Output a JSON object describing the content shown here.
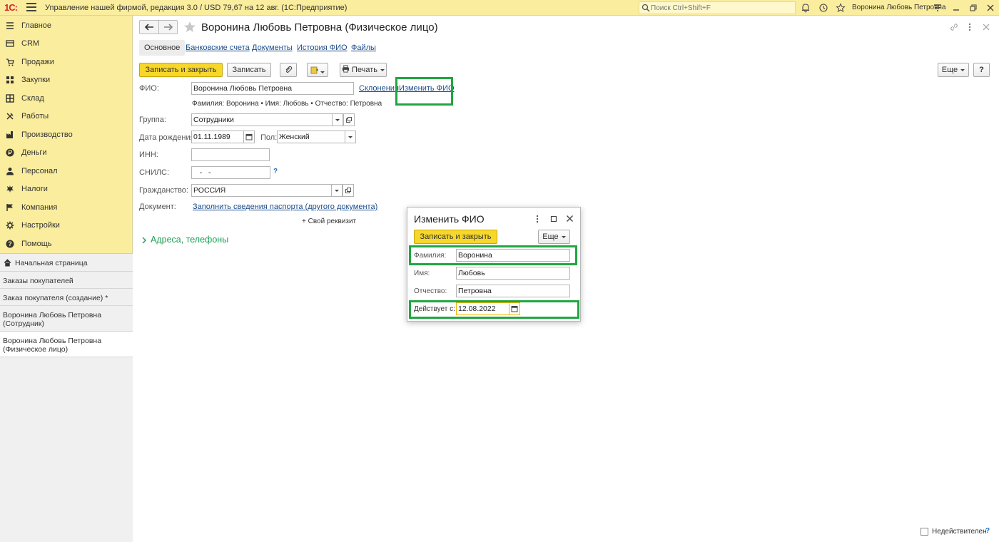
{
  "topbar": {
    "logo": "1С:",
    "app_title": "Управление нашей фирмой, редакция 3.0 / USD 79,67 на 12 авг.  (1С:Предприятие)",
    "search_placeholder": "Поиск Ctrl+Shift+F",
    "user_name": "Воронина Любовь Петровна"
  },
  "sidebar": {
    "items": [
      {
        "label": "Главное",
        "icon": "menu-lines-icon"
      },
      {
        "label": "CRM",
        "icon": "crm-icon"
      },
      {
        "label": "Продажи",
        "icon": "sales-icon"
      },
      {
        "label": "Закупки",
        "icon": "purchases-icon"
      },
      {
        "label": "Склад",
        "icon": "warehouse-icon"
      },
      {
        "label": "Работы",
        "icon": "tools-icon"
      },
      {
        "label": "Производство",
        "icon": "factory-icon"
      },
      {
        "label": "Деньги",
        "icon": "money-icon"
      },
      {
        "label": "Персонал",
        "icon": "person-icon"
      },
      {
        "label": "Налоги",
        "icon": "taxes-icon"
      },
      {
        "label": "Компания",
        "icon": "flag-icon"
      },
      {
        "label": "Настройки",
        "icon": "gear-icon"
      },
      {
        "label": "Помощь",
        "icon": "help-icon"
      }
    ],
    "open_windows": [
      {
        "label": "Начальная страница"
      },
      {
        "label": "Заказы покупателей"
      },
      {
        "label": "Заказ покупателя (создание) *"
      },
      {
        "label": "Воронина Любовь Петровна (Сотрудник)"
      },
      {
        "label": "Воронина Любовь Петровна (Физическое лицо)"
      }
    ]
  },
  "form": {
    "title": "Воронина Любовь Петровна (Физическое лицо)",
    "tabs": [
      "Основное",
      "Банковские счета",
      "Документы",
      "История ФИО",
      "Файлы"
    ],
    "toolbar": {
      "save_close": "Записать и закрыть",
      "save": "Записать",
      "print": "Печать",
      "more": "Еще",
      "help": "?"
    },
    "fio_label": "ФИО:",
    "fio_value": "Воронина Любовь Петровна",
    "declensions_link": "Склонения",
    "change_fio_link": "Изменить ФИО",
    "fio_breakdown": "Фамилия: Воронина • Имя: Любовь • Отчество: Петровна",
    "group_label": "Группа:",
    "group_value": "Сотрудники",
    "birth_label": "Дата рождения:",
    "birth_value": "01.11.1989",
    "gender_label": "Пол:",
    "gender_value": "Женский",
    "inn_label": "ИНН:",
    "inn_value": "",
    "snils_label": "СНИЛС:",
    "snils_value": "   -   -",
    "snils_help": "?",
    "citizenship_label": "Гражданство:",
    "citizenship_value": "РОССИЯ",
    "document_label": "Документ:",
    "document_link": "Заполнить сведения паспорта (другого документа)",
    "add_attribute": "+ Свой реквизит",
    "addresses_group": "Адреса, телефоны",
    "inactive_label": "Недействителен",
    "inactive_help": "?"
  },
  "dialog": {
    "title": "Изменить ФИО",
    "save_close": "Записать и закрыть",
    "more": "Еще",
    "surname_label": "Фамилия:",
    "surname_value": "Воронина",
    "name_label": "Имя:",
    "name_value": "Любовь",
    "patronymic_label": "Отчество:",
    "patronymic_value": "Петровна",
    "valid_from_label": "Действует с:",
    "valid_from_value": "12.08.2022"
  },
  "colors": {
    "accent_yellow": "#fbed9e",
    "primary_button": "#f7d72a",
    "highlight_green": "#1fa641",
    "link": "#1c4d8c",
    "group_green": "#1b9e52"
  }
}
